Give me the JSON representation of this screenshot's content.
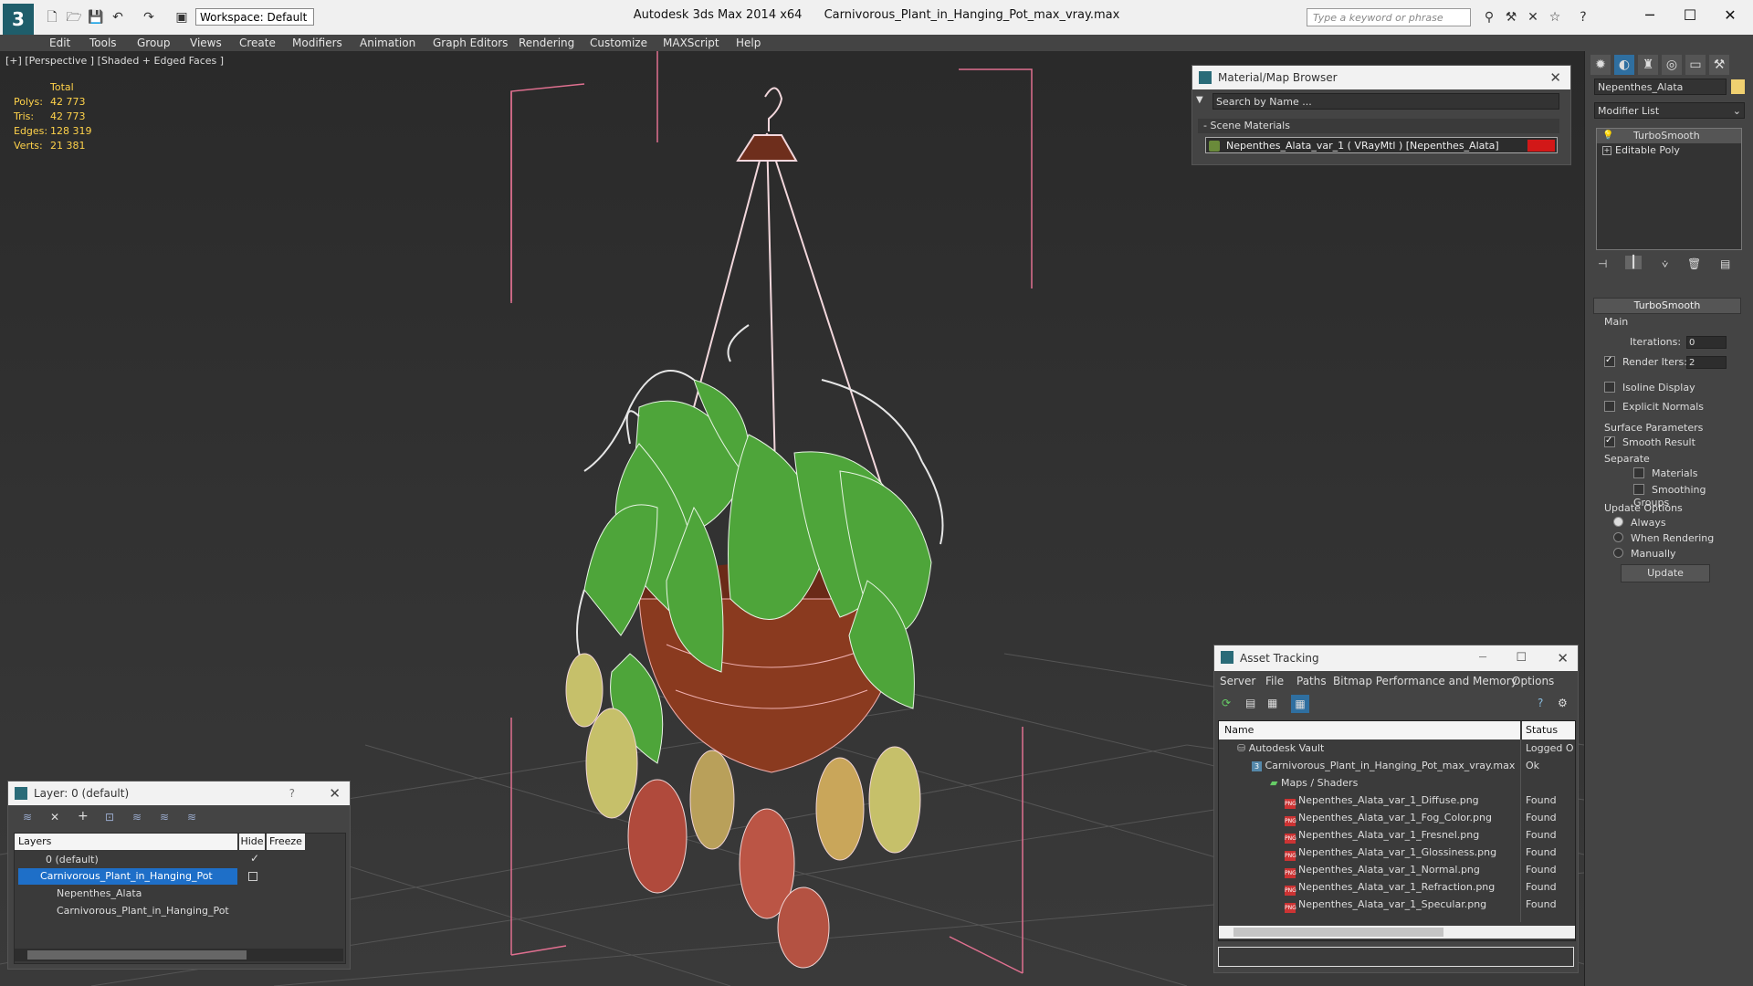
{
  "window": {
    "app_title": "Autodesk 3ds Max  2014 x64",
    "file_title": "Carnivorous_Plant_in_Hanging_Pot_max_vray.max",
    "workspace": "Workspace: Default",
    "search_placeholder": "Type a keyword or phrase"
  },
  "menu": [
    "Edit",
    "Tools",
    "Group",
    "Views",
    "Create",
    "Modifiers",
    "Animation",
    "Graph Editors",
    "Rendering",
    "Customize",
    "MAXScript",
    "Help"
  ],
  "viewport": {
    "label": "[+] [Perspective ] [Shaded + Edged Faces ]",
    "stats": {
      "header": "Total",
      "rows": [
        {
          "label": "Polys:",
          "value": "42 773"
        },
        {
          "label": "Tris:",
          "value": "42 773"
        },
        {
          "label": "Edges:",
          "value": "128 319"
        },
        {
          "label": "Verts:",
          "value": "21 381"
        }
      ]
    }
  },
  "material_browser": {
    "title": "Material/Map Browser",
    "search_placeholder": "Search by Name ...",
    "section": "Scene Materials",
    "item": "Nepenthes_Alata_var_1  ( VRayMtl )  [Nepenthes_Alata]"
  },
  "command_panel": {
    "object_name": "Nepenthes_Alata",
    "modifier_list": "Modifier List",
    "stack": [
      "TurboSmooth",
      "Editable Poly"
    ],
    "rollout_title": "TurboSmooth",
    "main_label": "Main",
    "iterations_label": "Iterations:",
    "iterations_value": "0",
    "render_iters_label": "Render Iters:",
    "render_iters_value": "2",
    "isoline": "Isoline Display",
    "explicit_normals": "Explicit Normals",
    "surface_params": "Surface Parameters",
    "smooth_result": "Smooth Result",
    "separate": "Separate",
    "materials": "Materials",
    "smoothing_groups": "Smoothing Groups",
    "update_options": "Update Options",
    "always": "Always",
    "when_rendering": "When Rendering",
    "manually": "Manually",
    "update_button": "Update"
  },
  "layer_panel": {
    "title": "Layer: 0 (default)",
    "help": "?",
    "columns": [
      "Layers",
      "Hide",
      "Freeze"
    ],
    "rows": [
      "0 (default)",
      "Carnivorous_Plant_in_Hanging_Pot",
      "Nepenthes_Alata",
      "Carnivorous_Plant_in_Hanging_Pot"
    ]
  },
  "asset_tracking": {
    "title": "Asset Tracking",
    "menu": [
      "Server",
      "File",
      "Paths",
      "Bitmap Performance and Memory",
      "Options"
    ],
    "columns": [
      "Name",
      "Status"
    ],
    "rows": [
      {
        "name": "Autodesk Vault",
        "status": "Logged O"
      },
      {
        "name": "Carnivorous_Plant_in_Hanging_Pot_max_vray.max",
        "status": "Ok"
      },
      {
        "name": "Maps / Shaders",
        "status": ""
      },
      {
        "name": "Nepenthes_Alata_var_1_Diffuse.png",
        "status": "Found"
      },
      {
        "name": "Nepenthes_Alata_var_1_Fog_Color.png",
        "status": "Found"
      },
      {
        "name": "Nepenthes_Alata_var_1_Fresnel.png",
        "status": "Found"
      },
      {
        "name": "Nepenthes_Alata_var_1_Glossiness.png",
        "status": "Found"
      },
      {
        "name": "Nepenthes_Alata_var_1_Normal.png",
        "status": "Found"
      },
      {
        "name": "Nepenthes_Alata_var_1_Refraction.png",
        "status": "Found"
      },
      {
        "name": "Nepenthes_Alata_var_1_Specular.png",
        "status": "Found"
      }
    ]
  }
}
